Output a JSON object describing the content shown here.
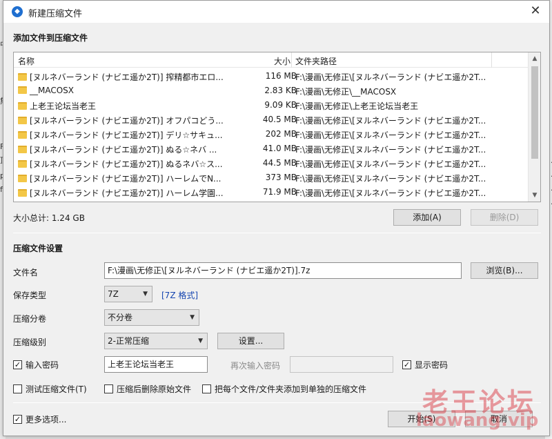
{
  "window": {
    "title": "新建压缩文件",
    "close_glyph": "✕",
    "app_icon_glyph": "◆"
  },
  "background_fragments": [
    "中",
    "無",
    "F",
    "頂",
    "p",
    "fl",
    "ι",
    "u",
    "t",
    "1.",
    "1.",
    "1.",
    "1."
  ],
  "files_section": {
    "title": "添加文件到压缩文件",
    "columns": {
      "name": "名称",
      "size": "大小",
      "path": "文件夹路径"
    },
    "rows": [
      {
        "name": "[ヌルネバーランド (ナビエ遥か2T)] 搾精都市エロ...",
        "size": "116 MB",
        "path": "F:\\漫画\\无修正\\[ヌルネバーランド (ナビエ遥か2T..."
      },
      {
        "name": "__MACOSX",
        "size": "2.83 KB",
        "path": "F:\\漫画\\无修正\\__MACOSX"
      },
      {
        "name": "上老王论坛当老王",
        "size": "9.09 KB",
        "path": "F:\\漫画\\无修正\\上老王论坛当老王"
      },
      {
        "name": "[ヌルネバーランド (ナビエ遥か2T)] オフパコどう...",
        "size": "40.5 MB",
        "path": "F:\\漫画\\无修正\\[ヌルネバーランド (ナビエ遥か2T..."
      },
      {
        "name": "[ヌルネバーランド (ナビエ遥か2T)] デリ☆サキュ...",
        "size": "202 MB",
        "path": "F:\\漫画\\无修正\\[ヌルネバーランド (ナビエ遥か2T..."
      },
      {
        "name": "[ヌルネバーランド (ナビエ遥か2T)] ぬる☆ネバ ...",
        "size": "41.0 MB",
        "path": "F:\\漫画\\无修正\\[ヌルネバーランド (ナビエ遥か2T..."
      },
      {
        "name": "[ヌルネバーランド (ナビエ遥か2T)] ぬるネバ☆ス...",
        "size": "44.5 MB",
        "path": "F:\\漫画\\无修正\\[ヌルネバーランド (ナビエ遥か2T..."
      },
      {
        "name": "[ヌルネバーランド (ナビエ遥か2T)] ハーレムでN...",
        "size": "373 MB",
        "path": "F:\\漫画\\无修正\\[ヌルネバーランド (ナビエ遥か2T..."
      },
      {
        "name": "[ヌルネバーランド (ナビエ遥か2T)] ハーレム学園...",
        "size": "71.9 MB",
        "path": "F:\\漫画\\无修正\\[ヌルネバーランド (ナビエ遥か2T..."
      }
    ],
    "total_size": "大小总计: 1.24 GB",
    "add_button": "添加(A)",
    "delete_button": "删除(D)"
  },
  "settings": {
    "title": "压缩文件设置",
    "filename_label": "文件名",
    "filename_value": "F:\\漫画\\无修正\\[ヌルネバーランド (ナビエ遥か2T)].7z",
    "browse_button": "浏览(B)...",
    "save_type_label": "保存类型",
    "save_type_value": "7Z",
    "format_link": "[7Z 格式]",
    "volume_label": "压缩分卷",
    "volume_value": "不分卷",
    "level_label": "压缩级别",
    "level_value": "2-正常压缩",
    "settings_button": "设置...",
    "password_check_label": "输入密码",
    "password_value": "上老王论坛当老王",
    "reenter_label": "再次输入密码",
    "reenter_value": "",
    "show_password_label": "显示密码",
    "test_label": "测试压缩文件(T)",
    "delete_after_label": "压缩后删除原始文件",
    "each_separate_label": "把每个文件/文件夹添加到单独的压缩文件",
    "more_options_label": "更多选项...",
    "start_button": "开始(S)",
    "cancel_button": "取消",
    "checked_glyph": "✓",
    "dropdown_glyph": "▼"
  },
  "checkbox_states": {
    "password": true,
    "show_password": true,
    "test": false,
    "delete_after": false,
    "each_separate": false,
    "more_options": true
  },
  "scroll_glyphs": {
    "up": "▲",
    "down": "▼"
  },
  "watermark": {
    "cn": "老王论坛",
    "url": "laowang.vip"
  }
}
